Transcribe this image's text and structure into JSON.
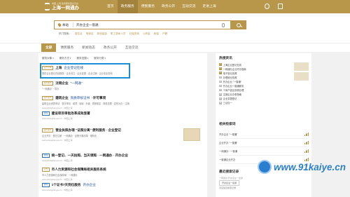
{
  "header": {
    "logo_title": "上海一网通办",
    "logo_sub": "中国·上海 政务服务官方平台",
    "nav": [
      "首页",
      "政务服务",
      "便民服务",
      "政务公开",
      "互动交流",
      "走进上海"
    ]
  },
  "search": {
    "city": "本站",
    "query": "开办企业一窗通",
    "hot_label": "热门搜索：",
    "hot_keywords": [
      "居住证",
      "驾驶证",
      "新冠疫苗",
      "职工退休人员",
      "社保查询",
      "公积金",
      "医保",
      "户籍"
    ]
  },
  "tabs": [
    "全部",
    "便民服务",
    "新闻动态",
    "政务公开",
    "互动交流"
  ],
  "filters": [
    "服务对象",
    "服务方式",
    "服务范围",
    "服务分类"
  ],
  "results": [
    {
      "tag": "官方全网",
      "title": "上海",
      "title_hl": "企业登记在线",
      "desc": "提供企业登记在线服务 · 企业设立 · 企业变更 · 企业注销 · 企业信息查询",
      "url": ""
    },
    {
      "tag": "政务服务",
      "title": "注销企业",
      "title_link": "\"一网通\"",
      "desc": "\"一网通办\" · 导办",
      "url": ""
    },
    {
      "tag": "政务服务",
      "title": "建筑企业",
      "title_link": "资质审核证书",
      "title_tail": "·许可事项",
      "desc": "建筑企业资质申请 · 首次申请 · 增项 · 延续 · 升级 · 重新核定 · 简单变更 · 遗失补办 · 注销",
      "url": "www.shanghai.gov.cn · 中国上海"
    },
    {
      "tag": "新闻",
      "title": "建设项目审批改革成效显著",
      "desc": "",
      "url": "www.shanghai.gov.cn · 中国上海"
    },
    {
      "tag": "政务服务",
      "title": "营业执照办理 \"证照分离\" 便利服务 · 企业登记",
      "desc": "企业开办 · 登记注册 · 一网通办 · 证照分离改革 · 便利化",
      "url": "www.shanghai.gov.cn · 中国上海"
    },
    {
      "tag": "新闻",
      "title": "统一登记、一天拍照、当天领照 · 一网通办 · 开办企业",
      "desc": "",
      "url": "www.shanghai.gov.cn · 中国上海"
    },
    {
      "tag": "公告",
      "title": "市人力资源和社会保障局相关服务系统",
      "desc": "市人力资源和社会保障局 · 一网通办",
      "url": "www.shanghai.gov.cn · 中国上海"
    },
    {
      "tag": "新闻",
      "title": "1个证书7天到位服务",
      "title_tail": "开办企业",
      "desc": "",
      "url": "www.shanghai.gov.cn · 中国上海"
    }
  ],
  "sidebar": {
    "hot_title": "热搜资讯",
    "hot_items": [
      "上海企业登记在线",
      "一网通办企业开办指南",
      "电子营业执照",
      "办理营业执照",
      "开办企业 \"一窗通\"",
      "开办企业一窗通服务",
      "个体户营业执照办理",
      "注销企业办事指南",
      "企业变更登记",
      "三证合一"
    ],
    "rel_title": "相关检索词",
    "rel_items": [
      "开办企业 \"一窗通\"",
      "企业开办 \"一窗通\"",
      "一网通办 · 一窗通",
      "一窗通企业开办"
    ],
    "recent_title": "最近搜索记录",
    "recent_tip": "一网通办 开办企业一窗通",
    "recent_tag": "开办企业一窗通",
    "recent_line": "清空最近搜索记录"
  },
  "watermark": "www.91kaiye.cn",
  "colors": {
    "brand": "#b8974a",
    "highlight_box": "#1a8fd6",
    "link": "#1e4fa0"
  }
}
